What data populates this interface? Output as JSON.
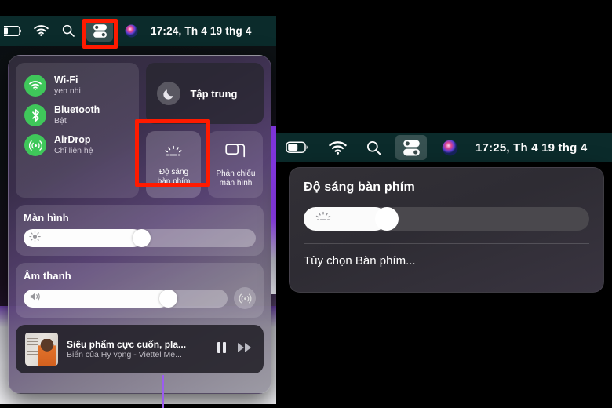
{
  "shot1": {
    "menubar": {
      "time": "17:24, Th 4 19 thg 4",
      "icons": [
        "battery-icon",
        "wifi-icon",
        "search-icon",
        "control-center-icon",
        "siri-icon"
      ]
    },
    "control_center": {
      "connectivity": [
        {
          "name": "wifi-icon",
          "title": "Wi-Fi",
          "status": "yen nhi"
        },
        {
          "name": "bluetooth-icon",
          "title": "Bluetooth",
          "status": "Bật"
        },
        {
          "name": "airdrop-icon",
          "title": "AirDrop",
          "status": "Chỉ liên hệ"
        }
      ],
      "focus": {
        "label": "Tập trung",
        "icon": "moon-icon"
      },
      "tiles": [
        {
          "icon": "keyboard-brightness-icon",
          "label": "Độ sáng\nbàn phím",
          "line1": "Độ sáng",
          "line2": "bàn phím",
          "highlighted": true
        },
        {
          "icon": "screen-mirroring-icon",
          "label": "Phản chiếu\nmàn hình",
          "line1": "Phản chiếu",
          "line2": "màn hình",
          "highlighted": false
        }
      ],
      "display": {
        "title": "Màn hình",
        "value": 50,
        "icon": "brightness-icon"
      },
      "sound": {
        "title": "Âm thanh",
        "value": 68,
        "icon": "volume-icon",
        "airplay_icon": "airplay-icon"
      },
      "media": {
        "title": "Siêu phẩm cực cuốn, pla...",
        "subtitle": "Biển của Hy vọng - Viettel Me...",
        "pause_icon": "pause-icon",
        "forward_icon": "fast-forward-icon",
        "artwork": "album-artwork"
      }
    }
  },
  "shot2": {
    "menubar": {
      "time": "17:25, Th 4 19 thg 4",
      "icons": [
        "battery-icon",
        "wifi-icon",
        "search-icon",
        "control-center-icon",
        "siri-icon"
      ]
    },
    "keyboard_popover": {
      "title": "Độ sáng bàn phím",
      "slider_value": 28,
      "slider_icon": "keyboard-brightness-icon",
      "option": "Tùy chọn Bàn phím..."
    }
  },
  "annotations": {
    "accent_color": "#ff1a00",
    "boxes": [
      {
        "name": "control-center-menubar-highlight"
      },
      {
        "name": "keyboard-brightness-tile-highlight"
      }
    ]
  }
}
